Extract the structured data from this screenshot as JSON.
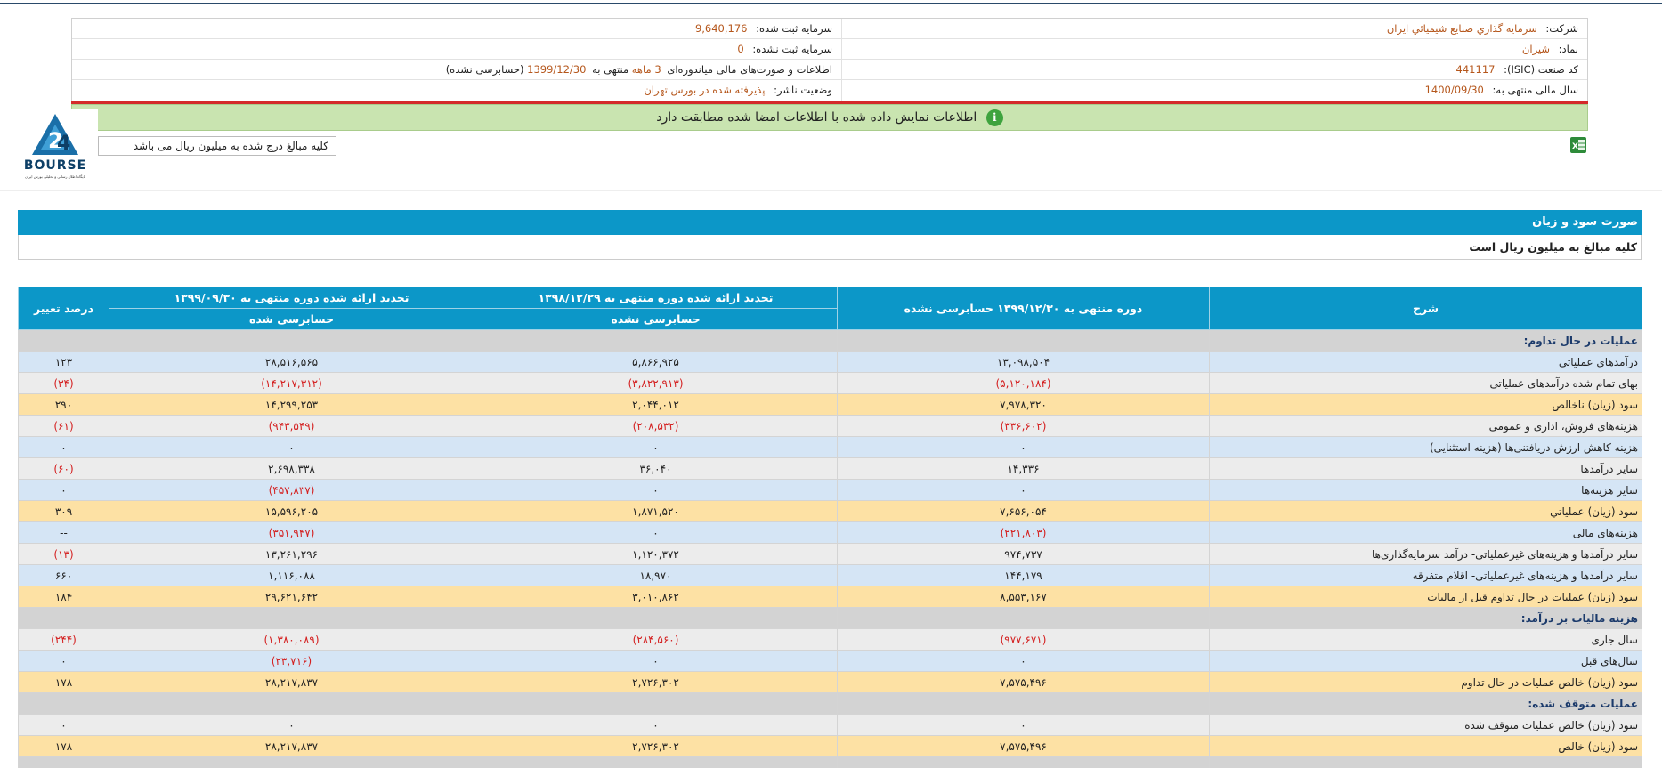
{
  "company_info": {
    "company_label": "شرکت:",
    "company_value": "سرمايه گذاري صنايع شيميائي ايران",
    "registered_capital_label": "سرمایه ثبت شده:",
    "registered_capital_value": "9,640,176",
    "symbol_label": "نماد:",
    "symbol_value": "شیران",
    "unregistered_capital_label": "سرمایه ثبت نشده:",
    "unregistered_capital_value": "0",
    "isic_label": "کد صنعت (ISIC):",
    "isic_value": "441117",
    "report_prefix": "اطلاعات و صورت‌های مالی میاندوره‌ای",
    "report_period": "3 ماهه",
    "report_mid": "منتهی به",
    "report_date": "1399/12/30",
    "report_suffix": "(حسابرسی نشده)",
    "fiscal_year_label": "سال مالی منتهی به:",
    "fiscal_year_value": "1400/09/30",
    "publisher_status_label": "وضعیت ناشر:",
    "publisher_status_value": "پذیرفته شده در بورس تهران"
  },
  "notice_text": "اطلاعات نمایش داده شده با اطلاعات امضا شده مطابقت دارد",
  "unit_note": "کلیه مبالغ درج شده به میلیون ریال می باشد",
  "logo_text": "BOURSE",
  "logo_subtext": "پایگاه اطلاع رسانی و تحلیلی بورس ایران",
  "statement": {
    "title": "صورت سود و زیان",
    "subtitle": "کلیه مبالغ به میلیون ریال است"
  },
  "table": {
    "headers": {
      "desc": "شرح",
      "col1": "دوره منتهی به ۱۳۹۹/۱۲/۳۰ حسابرسی نشده",
      "col2_top": "تجدید ارائه شده دوره منتهی به ۱۳۹۸/۱۲/۲۹",
      "col2_bottom": "حسابرسی نشده",
      "col3_top": "تجدید ارائه شده دوره منتهی به ۱۳۹۹/۰۹/۳۰",
      "col3_bottom": "حسابرسی شده",
      "col4": "درصد تغییر"
    },
    "rows": [
      {
        "type": "gray",
        "desc": "عملیات در حال تداوم:",
        "c1": "",
        "c2": "",
        "c3": "",
        "c4": ""
      },
      {
        "type": "blue",
        "desc": "درآمدهای عملیاتی",
        "c1": "۱۳,۰۹۸,۵۰۴",
        "c2": "۵,۸۶۶,۹۲۵",
        "c3": "۲۸,۵۱۶,۵۶۵",
        "c4": "۱۲۳"
      },
      {
        "type": "light",
        "desc": "بهاى تمام شده درآمدهای عملیاتی",
        "c1": "(۵,۱۲۰,۱۸۴)",
        "c2": "(۳,۸۲۲,۹۱۳)",
        "c3": "(۱۴,۲۱۷,۳۱۲)",
        "c4": "(۳۴)"
      },
      {
        "type": "yellow",
        "desc": "سود (زيان) ناخالص",
        "c1": "۷,۹۷۸,۳۲۰",
        "c2": "۲,۰۴۴,۰۱۲",
        "c3": "۱۴,۲۹۹,۲۵۳",
        "c4": "۲۹۰"
      },
      {
        "type": "light",
        "desc": "هزینه‌های فروش، اداری و عمومی",
        "c1": "(۳۳۶,۶۰۲)",
        "c2": "(۲۰۸,۵۳۲)",
        "c3": "(۹۴۳,۵۴۹)",
        "c4": "(۶۱)"
      },
      {
        "type": "blue",
        "desc": "هزینه کاهش ارزش دریافتنی‌ها (هزینه استثنایی)",
        "c1": "۰",
        "c2": "۰",
        "c3": "۰",
        "c4": "۰"
      },
      {
        "type": "light",
        "desc": "سایر درآمدها",
        "c1": "۱۴,۳۳۶",
        "c2": "۳۶,۰۴۰",
        "c3": "۲,۶۹۸,۳۳۸",
        "c4": "(۶۰)"
      },
      {
        "type": "blue",
        "desc": "سایر هزینه‌ها",
        "c1": "۰",
        "c2": "۰",
        "c3": "(۴۵۷,۸۳۷)",
        "c4": "۰"
      },
      {
        "type": "yellow",
        "desc": "سود (زيان) عملياتي",
        "c1": "۷,۶۵۶,۰۵۴",
        "c2": "۱,۸۷۱,۵۲۰",
        "c3": "۱۵,۵۹۶,۲۰۵",
        "c4": "۳۰۹"
      },
      {
        "type": "blue",
        "desc": "هزينه‌هاى مالى",
        "c1": "(۲۲۱,۸۰۳)",
        "c2": "۰",
        "c3": "(۳۵۱,۹۴۷)",
        "c4": "--"
      },
      {
        "type": "light",
        "desc": "سایر درآمدها و هزینه‌های غیرعملیاتی- درآمد سرمایه‌گذاری‌ها",
        "c1": "۹۷۴,۷۳۷",
        "c2": "۱,۱۲۰,۳۷۲",
        "c3": "۱۳,۲۶۱,۲۹۶",
        "c4": "(۱۳)"
      },
      {
        "type": "blue",
        "desc": "سایر درآمدها و هزینه‌های غیرعملیاتی- اقلام متفرقه",
        "c1": "۱۴۴,۱۷۹",
        "c2": "۱۸,۹۷۰",
        "c3": "۱,۱۱۶,۰۸۸",
        "c4": "۶۶۰"
      },
      {
        "type": "yellow",
        "desc": "سود (زيان) عمليات در حال تداوم قبل از ماليات",
        "c1": "۸,۵۵۳,۱۶۷",
        "c2": "۳,۰۱۰,۸۶۲",
        "c3": "۲۹,۶۲۱,۶۴۲",
        "c4": "۱۸۴"
      },
      {
        "type": "gray",
        "desc": "هزینه مالیات بر درآمد:",
        "c1": "",
        "c2": "",
        "c3": "",
        "c4": ""
      },
      {
        "type": "light",
        "desc": "سال جاری",
        "c1": "(۹۷۷,۶۷۱)",
        "c2": "(۲۸۴,۵۶۰)",
        "c3": "(۱,۳۸۰,۰۸۹)",
        "c4": "(۲۴۴)"
      },
      {
        "type": "blue",
        "desc": "سال‌های قبل",
        "c1": "۰",
        "c2": "۰",
        "c3": "(۲۳,۷۱۶)",
        "c4": "۰"
      },
      {
        "type": "yellow",
        "desc": "سود (زيان) خالص عمليات در حال تداوم",
        "c1": "۷,۵۷۵,۴۹۶",
        "c2": "۲,۷۲۶,۳۰۲",
        "c3": "۲۸,۲۱۷,۸۳۷",
        "c4": "۱۷۸"
      },
      {
        "type": "gray",
        "desc": "عملیات متوقف شده:",
        "c1": "",
        "c2": "",
        "c3": "",
        "c4": ""
      },
      {
        "type": "light",
        "desc": "سود (زيان) خالص عمليات متوقف شده",
        "c1": "۰",
        "c2": "۰",
        "c3": "۰",
        "c4": "۰"
      },
      {
        "type": "yellow",
        "desc": "سود (زيان) خالص",
        "c1": "۷,۵۷۵,۴۹۶",
        "c2": "۲,۷۲۶,۳۰۲",
        "c3": "۲۸,۲۱۷,۸۳۷",
        "c4": "۱۷۸"
      },
      {
        "type": "gray",
        "desc": "",
        "c1": "",
        "c2": "",
        "c3": "",
        "c4": ""
      }
    ]
  }
}
